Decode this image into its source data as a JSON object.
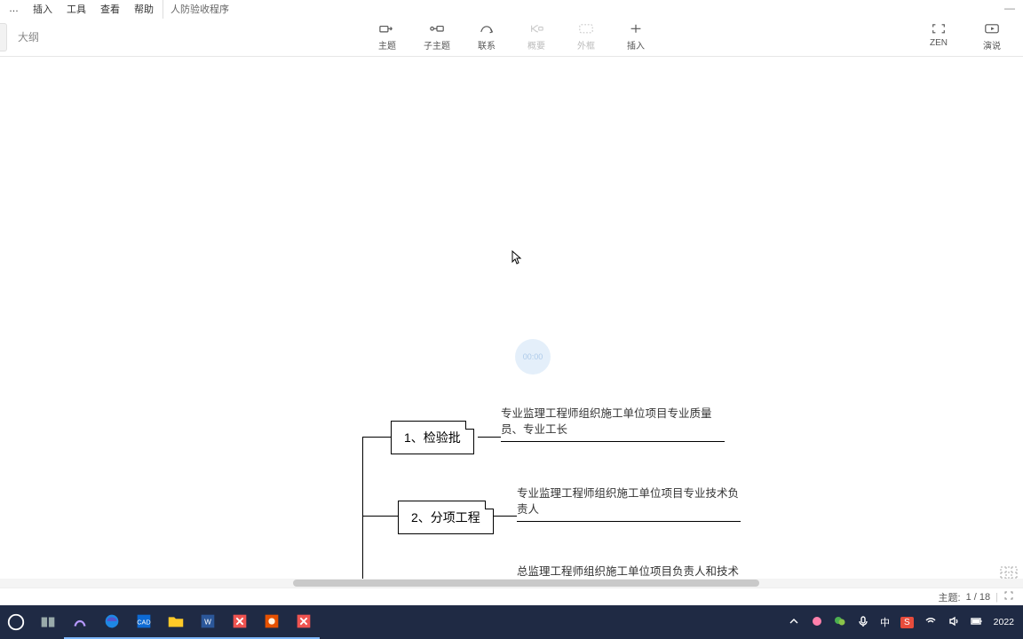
{
  "menu": {
    "m1": "…",
    "m2": "插入",
    "m3": "工具",
    "m4": "查看",
    "m5": "帮助"
  },
  "doc_title": "人防验收程序",
  "window": {
    "min": "—",
    "max": "",
    "close": ""
  },
  "view": {
    "outline": "大纲"
  },
  "toolbar": {
    "topic": "主题",
    "subtopic": "子主题",
    "relation": "联系",
    "summary": "概要",
    "boundary": "外框",
    "insert": "插入",
    "zen": "ZEN",
    "present": "演说"
  },
  "watermark": "00:00",
  "nodes": {
    "n1": "1、检验批",
    "n2": "2、分项工程",
    "t1": "专业监理工程师组织施工单位项目专业质量员、专业工长",
    "t2": "专业监理工程师组织施工单位项目专业技术负责人",
    "t3": "总监理工程师组织施工单位项目负责人和技术负…"
  },
  "status": {
    "label": "主题:",
    "count": "1 / 18"
  },
  "tray": {
    "ime_short": "中",
    "ime_badge": "S"
  },
  "clock": {
    "time": "",
    "date": "2022"
  }
}
